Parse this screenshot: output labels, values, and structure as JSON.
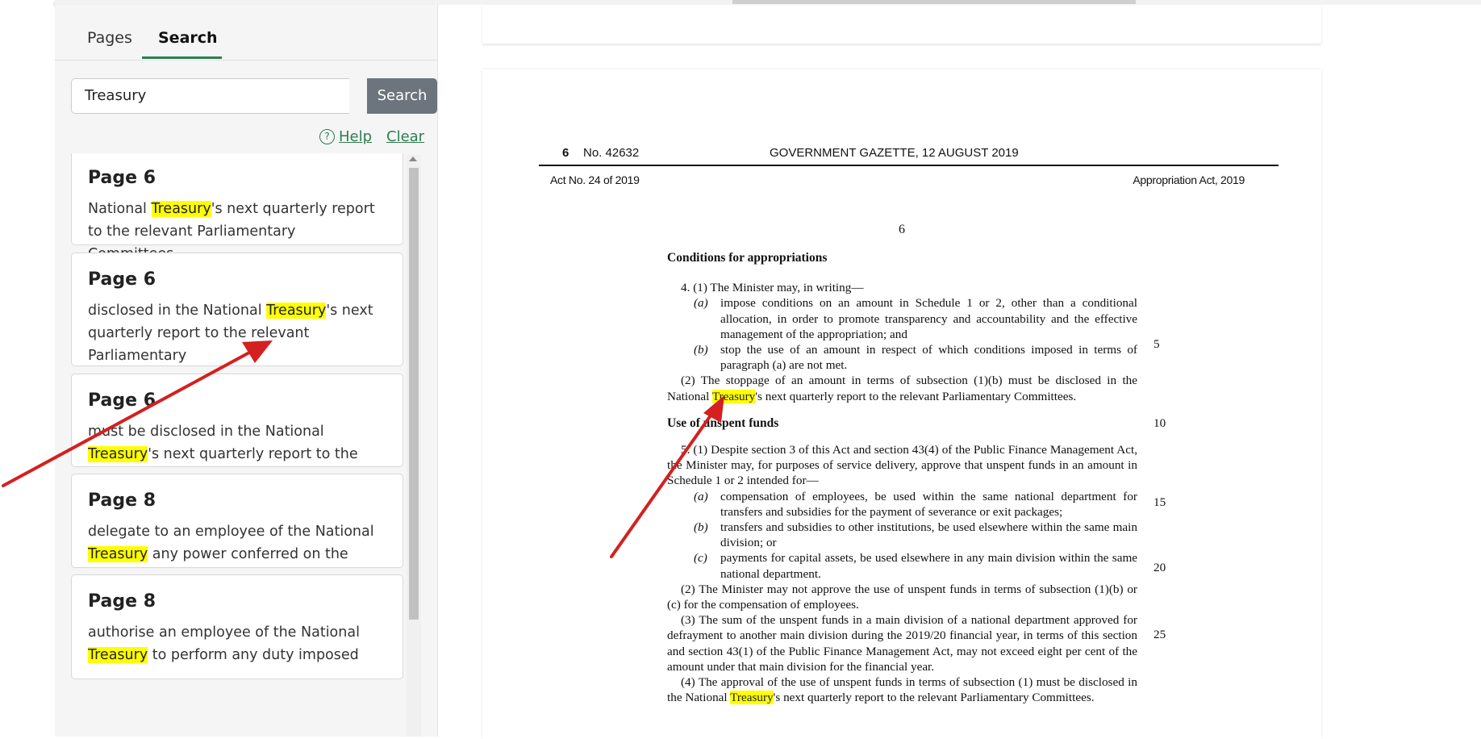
{
  "sidebar": {
    "tabs": {
      "pages": "Pages",
      "search": "Search"
    },
    "search": {
      "value": "Treasury",
      "button": "Search"
    },
    "links": {
      "help": "Help",
      "clear": "Clear"
    },
    "results": [
      {
        "page": "Page 6",
        "before": "National ",
        "term": "Treasury",
        "after": "'s next quarterly report to the relevant Parliamentary Committees."
      },
      {
        "page": "Page 6",
        "before": "disclosed in the National ",
        "term": "Treasury",
        "after": "'s next quarterly report to the relevant Parliamentary"
      },
      {
        "page": "Page 6",
        "before": "must be disclosed in the National ",
        "term": "Treasury",
        "after": "'s next quarterly report to the"
      },
      {
        "page": "Page 8",
        "before": "delegate to an employee of the National ",
        "term": "Treasury",
        "after": " any power conferred on the"
      },
      {
        "page": "Page 8",
        "before": "authorise an employee of the National ",
        "term": "Treasury",
        "after": " to perform any duty imposed"
      }
    ]
  },
  "document": {
    "page_number": "6",
    "gazette_no": "No. 42632",
    "gazette_title": "GOVERNMENT GAZETTE, 12 AUGUST 2019",
    "act_no": "Act No. 24 of 2019",
    "act_title": "Appropriation Act, 2019",
    "center_number": "6",
    "heading1": "Conditions for appropriations",
    "s4_intro": "4. (1) The Minister may, in writing—",
    "s4_a_lbl": "(a)",
    "s4_a": "impose conditions on an amount in Schedule 1 or 2, other than a conditional allocation, in order to promote transparency and accountability and the effective management of the appropriation; and",
    "s4_b_lbl": "(b)",
    "s4_b": "stop the use of an amount in respect of which conditions imposed in terms of paragraph (a) are not met.",
    "s4_2_before": "(2) The stoppage of an amount in terms of subsection (1)(b) must be disclosed in the National ",
    "s4_2_term": "Treasury",
    "s4_2_after": "'s next quarterly report to the relevant Parliamentary Committees.",
    "heading2": "Use of unspent funds",
    "s5_intro": "5. (1) Despite section 3 of this Act and section 43(4) of the Public Finance Management Act, the Minister may, for purposes of service delivery, approve that unspent funds in an amount in Schedule 1 or 2 intended for—",
    "s5_a_lbl": "(a)",
    "s5_a": "compensation of employees, be used within the same national department for transfers and subsidies for the payment of severance or exit packages;",
    "s5_b_lbl": "(b)",
    "s5_b": "transfers and subsidies to other institutions, be used elsewhere within the same main division; or",
    "s5_c_lbl": "(c)",
    "s5_c": "payments for capital assets, be used elsewhere in any main division within the same national department.",
    "s5_2": "(2) The Minister may not approve the use of unspent funds in terms of subsection (1)(b) or (c) for the compensation of employees.",
    "s5_3": "(3) The sum of the unspent funds in a main division of a national department approved for defrayment to another main division during the 2019/20 financial year, in terms of this section and section 43(1) of the Public Finance Management Act, may not exceed eight per cent of the amount under that main division for the financial year.",
    "s5_4_before": "(4) The approval of the use of unspent funds in terms of subsection (1) must be disclosed in the National ",
    "s5_4_term": "Treasury",
    "s5_4_after": "'s next quarterly report to the relevant Parliamentary Committees.",
    "margin_numbers": [
      "5",
      "10",
      "15",
      "20",
      "25"
    ]
  },
  "colors": {
    "highlight": "#ffff00",
    "accent": "#2e7d4f",
    "button": "#6c757d",
    "arrow": "#d42020"
  }
}
